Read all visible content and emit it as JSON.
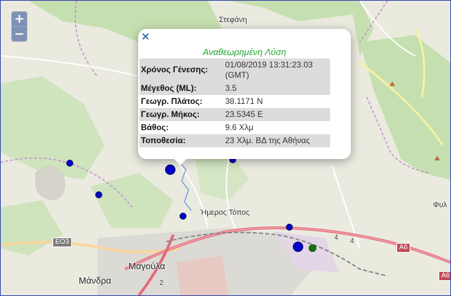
{
  "zoom": {
    "in_label": "+",
    "out_label": "−"
  },
  "map_labels": {
    "stefani": "Στεφάνη",
    "imeros_topos": "Ήμερος Τόπος",
    "magoula": "Μαγούλα",
    "mandra": "Μάνδρα",
    "fyli": "Φυλ"
  },
  "road_shields": {
    "e03": "ΕΟ3",
    "a6": "Α6",
    "a6b": "Α6",
    "n4a": "4",
    "n4b": "4",
    "n2": "2"
  },
  "popup": {
    "close_label": "×",
    "title": "Αναθεωρημένη Λύση",
    "rows": [
      {
        "key": "Χρόνος Γένεσης:",
        "value": "01/08/2019 13:31:23.03 (GMT)"
      },
      {
        "key": "Μέγεθος (ML):",
        "value": "3.5"
      },
      {
        "key": "Γεωγρ. Πλάτος:",
        "value": "38.1171 N"
      },
      {
        "key": "Γεωγρ. Μήκος:",
        "value": "23.5345 E"
      },
      {
        "key": "Βάθος:",
        "value": "9.6 Χλμ"
      },
      {
        "key": "Τοποθεσία:",
        "value": "23 Χλμ. ΒΔ της Αθήνας"
      }
    ]
  },
  "colors": {
    "quake_blue": "#0000cc",
    "quake_green": "#117711",
    "popup_title": "#22aa33",
    "frame": "#2b3ea8"
  }
}
